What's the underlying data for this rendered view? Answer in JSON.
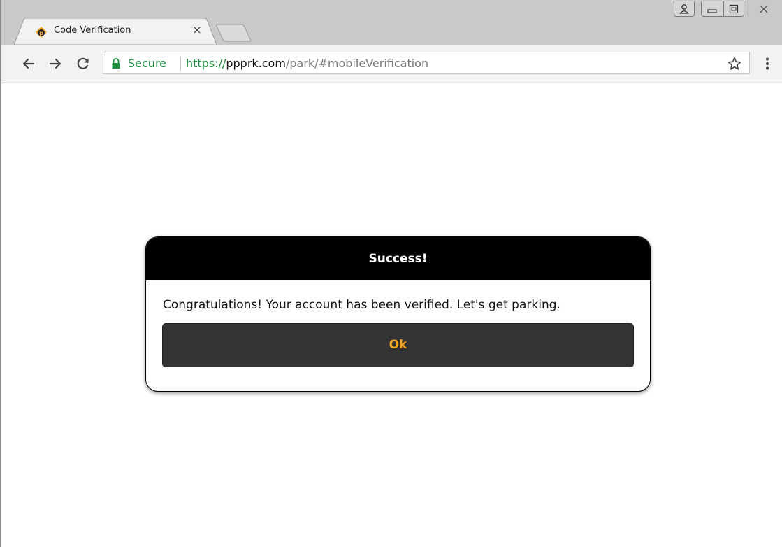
{
  "browser": {
    "tab": {
      "title": "Code Verification",
      "close_glyph": "×",
      "favicon": "ppprk-logo"
    },
    "window_controls": [
      "profile-icon",
      "minimize-icon",
      "maximize-icon",
      "close-icon"
    ],
    "toolbar": {
      "back_icon": "back-arrow-icon",
      "forward_icon": "forward-arrow-icon",
      "reload_icon": "reload-icon",
      "security_label": "Secure",
      "url_scheme": "https://",
      "url_host": "ppprk.com",
      "url_path": "/park/#mobileVerification",
      "bookmark_icon": "star-icon",
      "menu_icon": "kebab-menu-icon"
    }
  },
  "dialog": {
    "title": "Success!",
    "message": "Congratulations! Your account has been verified. Let's get parking.",
    "ok_label": "Ok"
  },
  "colors": {
    "secure_green": "#1e8e3e",
    "dialog_header": "#000000",
    "button_bg": "#333333",
    "button_text": "#f5a623",
    "favicon_orange": "#f5a623"
  }
}
